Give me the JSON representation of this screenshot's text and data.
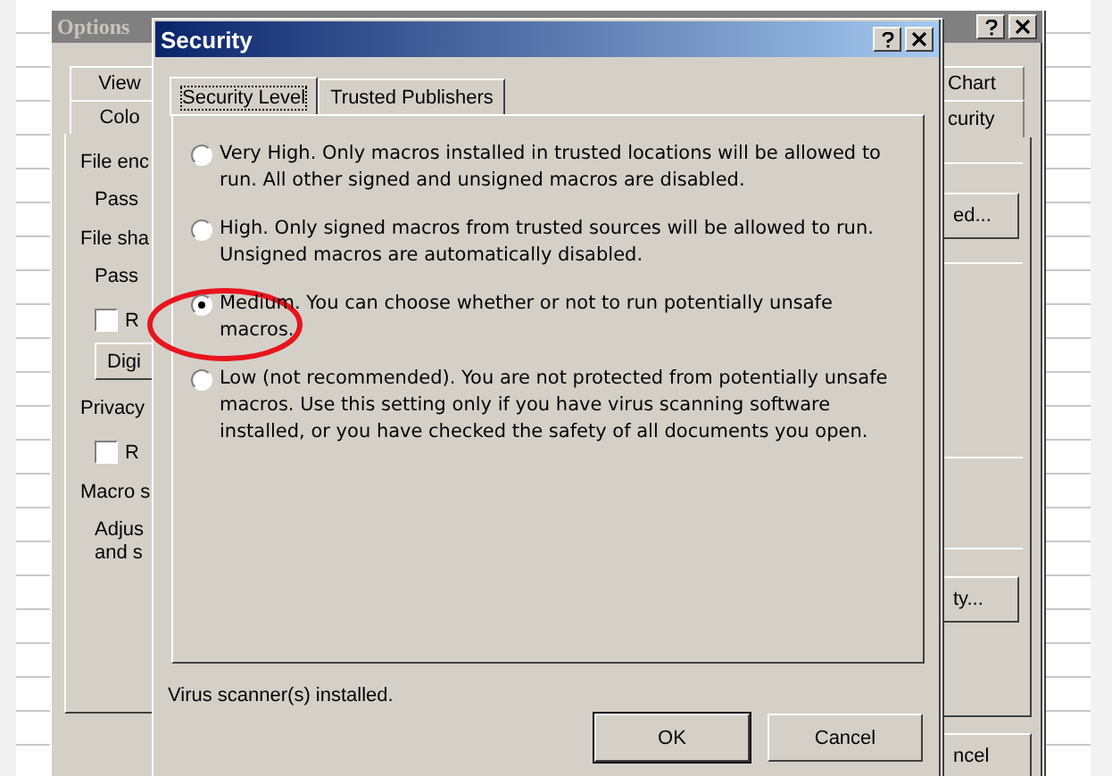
{
  "options_window": {
    "title": "Options",
    "left_tabs": [
      {
        "label": "View",
        "selected": false
      },
      {
        "label": "Colo",
        "selected": false
      }
    ],
    "right_tabs": [
      {
        "label": "Chart",
        "selected": false
      },
      {
        "label": "curity",
        "selected": true
      }
    ],
    "left_items": [
      {
        "kind": "heading",
        "text": "File enc"
      },
      {
        "kind": "label",
        "text": "Pass"
      },
      {
        "kind": "heading",
        "text": "File sha"
      },
      {
        "kind": "label",
        "text": "Pass"
      },
      {
        "kind": "checkbox",
        "text": "R",
        "checked": false
      },
      {
        "kind": "button",
        "text": "Digi"
      },
      {
        "kind": "heading",
        "text": "Privacy"
      },
      {
        "kind": "checkbox",
        "text": "R",
        "checked": false
      },
      {
        "kind": "heading",
        "text": "Macro s"
      },
      {
        "kind": "label",
        "text": "Adjus"
      },
      {
        "kind": "label",
        "text": "and s"
      }
    ],
    "right_buttons": [
      "ed...",
      "ty..."
    ],
    "footer_button": "ncel"
  },
  "security_dialog": {
    "title": "Security",
    "tabs": [
      {
        "label": "Security Level",
        "selected": true
      },
      {
        "label": "Trusted Publishers",
        "selected": false
      }
    ],
    "options": [
      {
        "text": "Very High. Only macros installed in trusted locations will be allowed to run. All other signed and unsigned macros are disabled.",
        "selected": false
      },
      {
        "text": "High. Only signed macros from trusted sources will be allowed to run. Unsigned macros are automatically disabled.",
        "selected": false
      },
      {
        "text": "Medium. You can choose whether or not to run potentially unsafe macros.",
        "selected": true
      },
      {
        "text": "Low (not recommended). You are not protected from potentially unsafe macros. Use this setting only if you have virus scanning software installed, or you have checked the safety of all documents you open.",
        "selected": false
      }
    ],
    "status": "Virus scanner(s) installed.",
    "buttons": [
      "OK",
      "Cancel"
    ]
  }
}
